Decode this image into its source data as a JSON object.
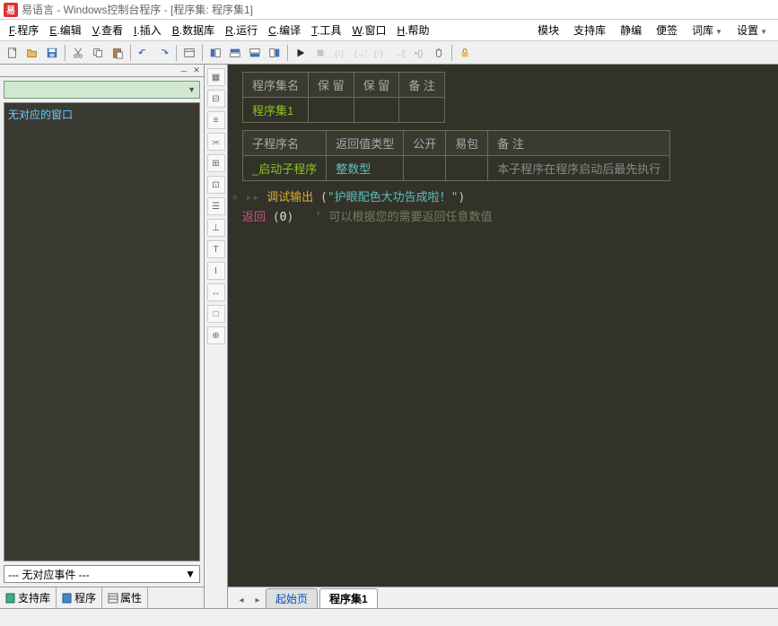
{
  "title": "易语言 - Windows控制台程序 - [程序集: 程序集1]",
  "menu": {
    "items": [
      {
        "key": "F",
        "label": "程序"
      },
      {
        "key": "E",
        "label": "编辑"
      },
      {
        "key": "V",
        "label": "查看"
      },
      {
        "key": "I",
        "label": "插入"
      },
      {
        "key": "B",
        "label": "数据库"
      },
      {
        "key": "R",
        "label": "运行"
      },
      {
        "key": "C",
        "label": "编译"
      },
      {
        "key": "T",
        "label": "工具"
      },
      {
        "key": "W",
        "label": "窗口"
      },
      {
        "key": "H",
        "label": "帮助"
      }
    ],
    "right": [
      "模块",
      "支持库",
      "静编",
      "便签",
      "词库",
      "设置"
    ]
  },
  "left_panel": {
    "tree_text": "无对应的窗口",
    "event_text": "--- 无对应事件 ---",
    "tabs": [
      "支持库",
      "程序",
      "属性"
    ]
  },
  "editor": {
    "table1": {
      "headers": [
        "程序集名",
        "保 留",
        "保 留",
        "备 注"
      ],
      "row": [
        "程序集1",
        "",
        "",
        ""
      ]
    },
    "table2": {
      "headers": [
        "子程序名",
        "返回值类型",
        "公开",
        "易包",
        "备 注"
      ],
      "row": [
        "_启动子程序",
        "整数型",
        "",
        "",
        "本子程序在程序启动后最先执行"
      ]
    },
    "code": {
      "line1_fn": "调试输出",
      "line1_str": "\"护眼配色大功告成啦！\"",
      "line2_ret": "返回",
      "line2_val": "0",
      "line2_comment": "' 可以根据您的需要返回任意数值"
    },
    "tabs": {
      "start": "起始页",
      "active": "程序集1"
    }
  },
  "icons": {
    "new": "new",
    "open": "open",
    "save": "save",
    "cut": "cut",
    "copy": "copy",
    "paste": "paste",
    "undo": "undo",
    "redo": "redo"
  }
}
